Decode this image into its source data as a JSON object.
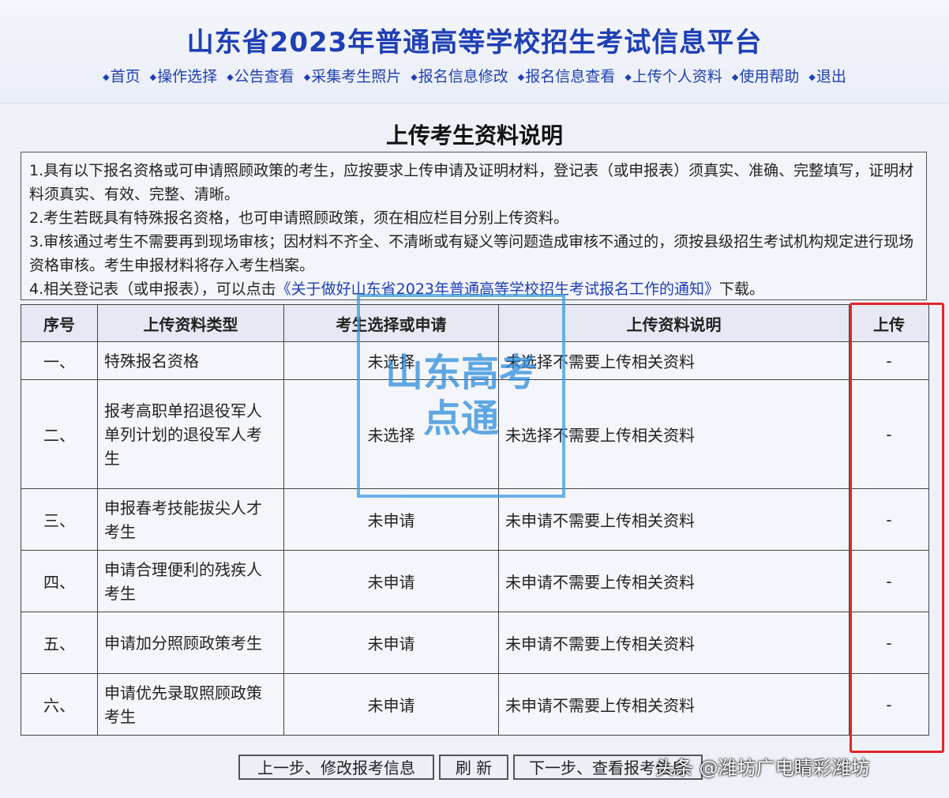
{
  "header": {
    "title": "山东省2023年普通高等学校招生考试信息平台",
    "nav": [
      {
        "label": "首页"
      },
      {
        "label": "操作选择"
      },
      {
        "label": "公告查看"
      },
      {
        "label": "采集考生照片"
      },
      {
        "label": "报名信息修改"
      },
      {
        "label": "报名信息查看"
      },
      {
        "label": "上传个人资料"
      },
      {
        "label": "使用帮助"
      },
      {
        "label": "退出"
      }
    ],
    "nav_bullet": "◆"
  },
  "main": {
    "heading": "上传考生资料说明",
    "notice": {
      "p1": "1.具有以下报名资格或可申请照顾政策的考生，应按要求上传申请及证明材料，登记表（或申报表）须真实、准确、完整填写，证明材料须真实、有效、完整、清晰。",
      "p2": "2.考生若既具有特殊报名资格，也可申请照顾政策，须在相应栏目分别上传资料。",
      "p3": "3.审核通过考生不需要再到现场审核；因材料不齐全、不清晰或有疑义等问题造成审核不通过的，须按县级招生考试机构规定进行现场资格审核。考生申报材料将存入考生档案。",
      "p4_prefix": "4.相关登记表（或申报表），可以点击",
      "p4_link": "《关于做好山东省2023年普通高等学校招生考试报名工作的通知》",
      "p4_suffix": "下载。"
    },
    "table": {
      "headers": [
        "序号",
        "上传资料类型",
        "考生选择或申请",
        "上传资料说明",
        "上传"
      ],
      "rows": [
        {
          "no": "一、",
          "type": "特殊报名资格",
          "status": "未选择",
          "desc": "未选择不需要上传相关资料",
          "upload": "-"
        },
        {
          "no": "二、",
          "type": "报考高职单招退役军人单列计划的退役军人考生",
          "status": "未选择",
          "desc": "未选择不需要上传相关资料",
          "upload": "-"
        },
        {
          "no": "三、",
          "type": "申报春考技能拔尖人才考生",
          "status": "未申请",
          "desc": "未申请不需要上传相关资料",
          "upload": "-"
        },
        {
          "no": "四、",
          "type": "申请合理便利的残疾人考生",
          "status": "未申请",
          "desc": "未申请不需要上传相关资料",
          "upload": "-"
        },
        {
          "no": "五、",
          "type": "申请加分照顾政策考生",
          "status": "未申请",
          "desc": "未申请不需要上传相关资料",
          "upload": "-"
        },
        {
          "no": "六、",
          "type": "申请优先录取照顾政策考生",
          "status": "未申请",
          "desc": "未申请不需要上传相关资料",
          "upload": "-"
        }
      ]
    },
    "buttons": {
      "prev": "上一步、修改报考信息",
      "refresh": "刷 新",
      "next": "下一步、查看报考信息"
    }
  },
  "watermark": {
    "line1": "山东高考",
    "line2": "点通"
  },
  "credit": "头条 @潍坊广电睛彩潍坊",
  "colors": {
    "title": "#1f3fb5",
    "highlight": "#e0262a",
    "watermark": "#2e8ddb"
  }
}
